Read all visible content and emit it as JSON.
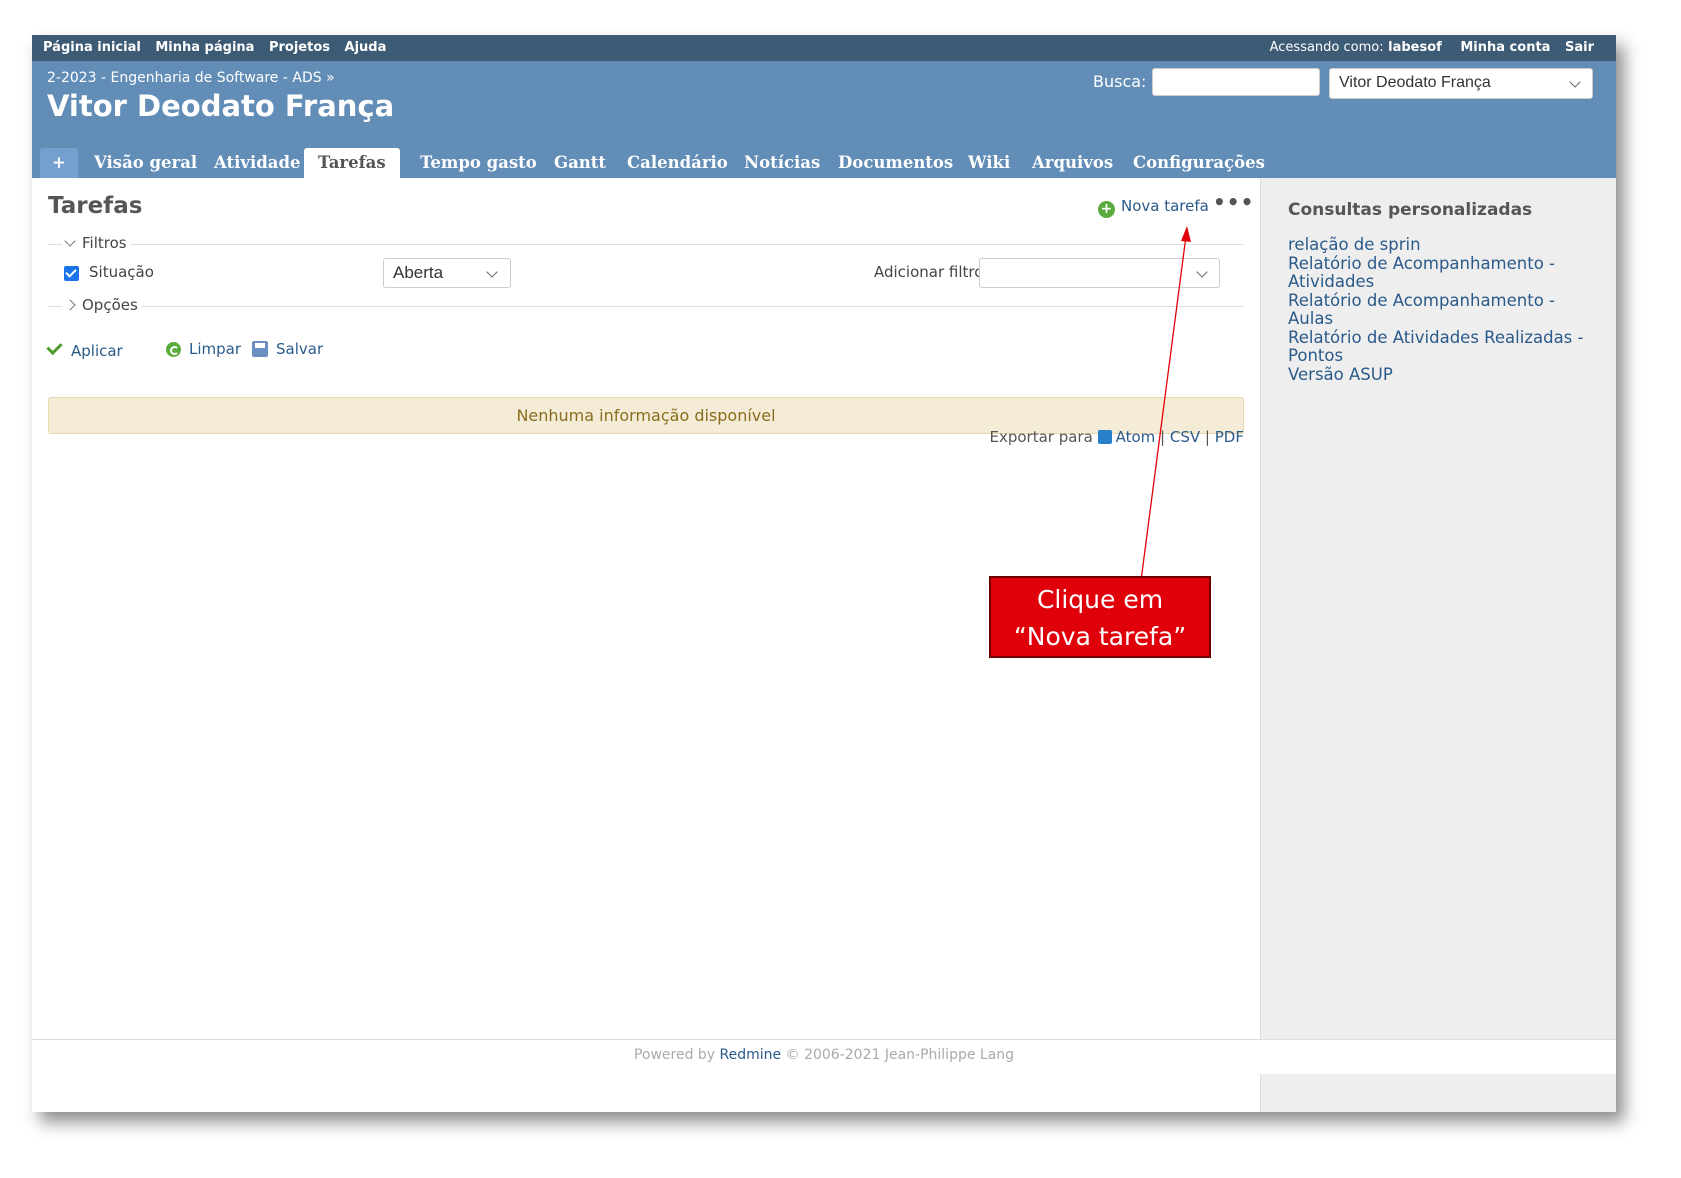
{
  "top_menu": {
    "links": [
      "Página inicial",
      "Minha página",
      "Projetos",
      "Ajuda"
    ],
    "logged_as_label": "Acessando como:",
    "user": "labesof",
    "my_account": "Minha conta",
    "logout": "Sair"
  },
  "header": {
    "breadcrumb": "2-2023 - Engenharia de Software - ADS »",
    "title": "Vitor Deodato França",
    "search_label": "Busca:",
    "project_jump_value": "Vitor Deodato França"
  },
  "tabs": [
    "+",
    "Visão geral",
    "Atividade",
    "Tarefas",
    "Tempo gasto",
    "Gantt",
    "Calendário",
    "Notícias",
    "Documentos",
    "Wiki",
    "Arquivos",
    "Configurações"
  ],
  "selected_tab": "Tarefas",
  "content": {
    "title": "Tarefas",
    "new_issue": "Nova tarefa",
    "more": "•••",
    "filters_legend": "Filtros",
    "status_label": "Situação",
    "status_value": "Aberta",
    "add_filter_label": "Adicionar filtro",
    "options_legend": "Opções",
    "apply": "Aplicar",
    "clear": "Limpar",
    "save": "Salvar",
    "no_data": "Nenhuma informação disponível",
    "export_label": "Exportar para",
    "export_atom": "Atom",
    "export_csv": "CSV",
    "export_pdf": "PDF",
    "sep": "|"
  },
  "sidebar": {
    "title": "Consultas personalizadas",
    "queries": [
      "relação de sprin",
      "Relatório de Acompanhamento - Atividades",
      "Relatório de Acompanhamento - Aulas",
      "Relatório de Atividades Realizadas - Pontos",
      "Versão ASUP"
    ]
  },
  "footer": {
    "powered": "Powered by",
    "redmine": "Redmine",
    "copyright": "© 2006-2021 Jean-Philippe Lang"
  },
  "annotation": {
    "line1": "Clique em",
    "line2": "“Nova tarefa”"
  },
  "colors": {
    "top_bar": "#3e5b76",
    "header": "#628db6",
    "link": "#2a5a8a",
    "callout": "#e0000a"
  }
}
